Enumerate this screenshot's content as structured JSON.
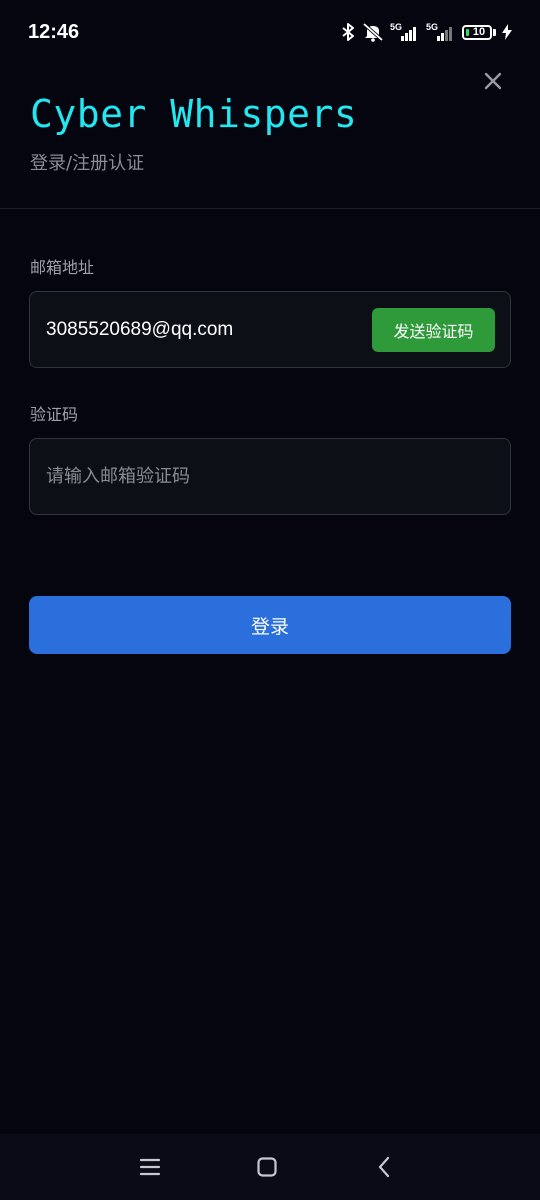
{
  "status_bar": {
    "time": "12:46",
    "network_1": "5G",
    "network_2": "5G",
    "battery": "10",
    "icons": [
      "bluetooth-icon",
      "mute-icon",
      "signal-icon",
      "signal-icon",
      "battery-icon",
      "charging-icon"
    ]
  },
  "header": {
    "title": "Cyber Whispers",
    "subtitle": "登录/注册认证",
    "close_icon": "close-icon"
  },
  "form": {
    "email_label": "邮箱地址",
    "email_value": "3085520689@qq.com",
    "send_code_label": "发送验证码",
    "code_label": "验证码",
    "code_placeholder": "请输入邮箱验证码",
    "code_value": ""
  },
  "login_label": "登录",
  "nav_bar": {
    "icons": [
      "menu-icon",
      "home-icon",
      "back-icon"
    ]
  },
  "colors": {
    "background": "#05050f",
    "title_accent": "#22e6f0",
    "send_button": "#2e9a3a",
    "login_button": "#2a6fdc"
  }
}
